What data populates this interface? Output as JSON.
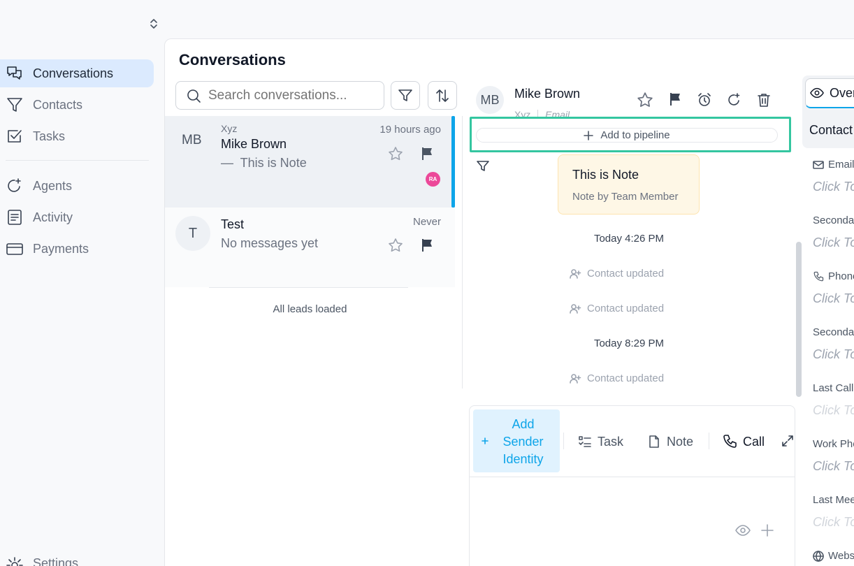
{
  "main": {
    "title": "Conversations"
  },
  "sidebar": {
    "items": [
      {
        "label": "Conversations",
        "icon": "chat-bubbles-icon",
        "active": true
      },
      {
        "label": "Contacts",
        "icon": "filter-icon"
      },
      {
        "label": "Tasks",
        "icon": "checkbox-icon"
      },
      {
        "label": "Agents",
        "icon": "sparkle-refresh-icon"
      },
      {
        "label": "Activity",
        "icon": "document-list-icon"
      },
      {
        "label": "Payments",
        "icon": "credit-card-icon"
      }
    ],
    "settings_label": "Settings"
  },
  "search": {
    "placeholder": "Search conversations..."
  },
  "conversations": [
    {
      "initials": "MB",
      "company": "Xyz",
      "name": "Mike Brown",
      "preview": "—  This is Note",
      "time": "19 hours ago",
      "assignee": "RA"
    },
    {
      "initials": "T",
      "name": "Test",
      "preview": "No messages yet",
      "time": "Never"
    }
  ],
  "list_footer": "All leads loaded",
  "detail": {
    "initials": "MB",
    "name": "Mike Brown",
    "company": "Xyz",
    "channel": "Email",
    "pipeline_label": "Add to pipeline",
    "note": {
      "title": "This is Note",
      "by": "Note by Team Member"
    },
    "timeline": [
      {
        "type": "date",
        "text": "Today 4:26 PM"
      },
      {
        "type": "event",
        "text": "Contact updated"
      },
      {
        "type": "event",
        "text": "Contact updated"
      },
      {
        "type": "date",
        "text": "Today 8:29 PM"
      },
      {
        "type": "event",
        "text": "Contact updated"
      }
    ],
    "composer": {
      "sender_label": "Add Sender Identity",
      "task_label": "Task",
      "note_label": "Note",
      "call_label": "Call"
    }
  },
  "right_panel": {
    "tab_label": "Overview",
    "section_title": "Contact",
    "fields": [
      {
        "label": "Email",
        "value": "Click To"
      },
      {
        "label": "Secondary",
        "value": "Click To"
      },
      {
        "label": "Phone",
        "value": "Click To"
      },
      {
        "label": "Secondary",
        "value": "Click To"
      },
      {
        "label": "Last Call",
        "value": "Click To"
      },
      {
        "label": "Work Phone",
        "value": "Click To"
      },
      {
        "label": "Last Meeting",
        "value": "Click To"
      },
      {
        "label": "Website",
        "value": ""
      }
    ]
  },
  "colors": {
    "accent": "#0ea5e9",
    "active_nav": "#dbeafe",
    "highlight_border": "#34c6a0",
    "badge": "#ec4899",
    "note_bg": "#fef7e6"
  }
}
